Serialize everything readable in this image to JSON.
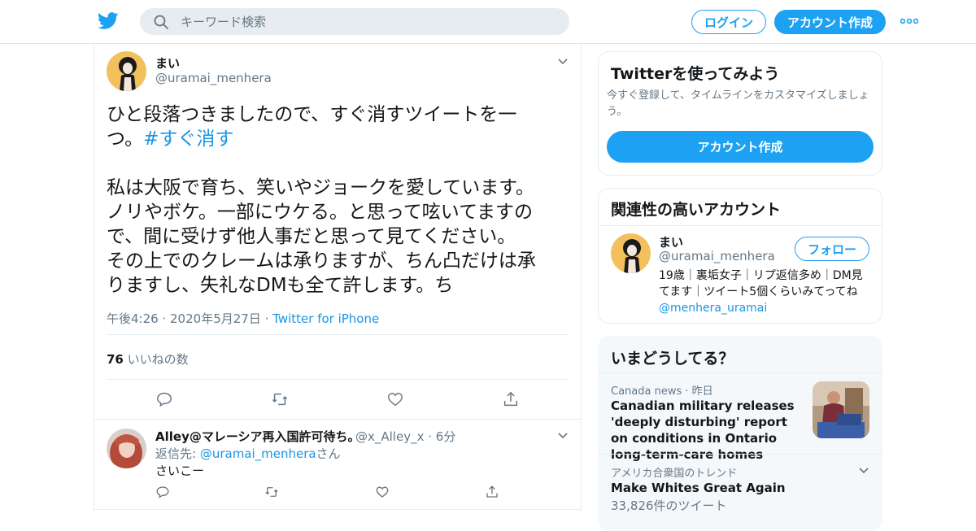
{
  "topbar": {
    "search_placeholder": "キーワード検索",
    "login_label": "ログイン",
    "signup_label": "アカウント作成",
    "brand_color": "#1da1f2"
  },
  "tweet": {
    "name": "まい",
    "handle": "@uramai_menhera",
    "text_1": "ひと段落つきましたので、すぐ消すツイートを一\nつ。",
    "hashtag": "#すぐ消す",
    "text_2": "\n\n私は大阪で育ち、笑いやジョークを愛しています。\nノリやボケ。一部にウケる。と思って呟いてますの\nで、間に受けず他人事だと思って見てください。\nその上でのクレームは承りますが、ちん凸だけは承\nりますし、失礼なDMも全て許します。ち",
    "time": "午後4:26",
    "date": "2020年5月27日",
    "source": "Twitter for iPhone",
    "likes_count": "76",
    "likes_label": "いいねの数"
  },
  "reply": {
    "name": "Alley@マレーシア再入国許可待ち。",
    "handle": "@x_Alley_x",
    "time": "6分",
    "reply_to_label": "返信先: ",
    "reply_to_mention": "@uramai_menhera",
    "reply_to_suffix": "さん",
    "text": "さいこー"
  },
  "signup_card": {
    "title": "Twitterを使ってみよう",
    "description": "今すぐ登録して、タイムラインをカスタマイズしましょう。",
    "button_label": "アカウント作成"
  },
  "related_card": {
    "title": "関連性の高いアカウント",
    "name": "まい",
    "handle": "@uramai_menhera",
    "follow_label": "フォロー",
    "bio": "19歳｜裏垢女子｜リプ返信多め｜DM見てます｜ツイート5個くらいみてってね",
    "bio_mention": "@menhera_uramai"
  },
  "trends_card": {
    "title": "いまどうしてる？",
    "news_source": "Canada news",
    "news_time": "昨日",
    "news_title": "Canadian military releases 'deeply disturbing' report on conditions in Ontario long-term-care homes",
    "trend_region": "アメリカ合衆国のトレンド",
    "trend_title": "Make Whites Great Again",
    "trend_count": "33,826件のツイート"
  }
}
